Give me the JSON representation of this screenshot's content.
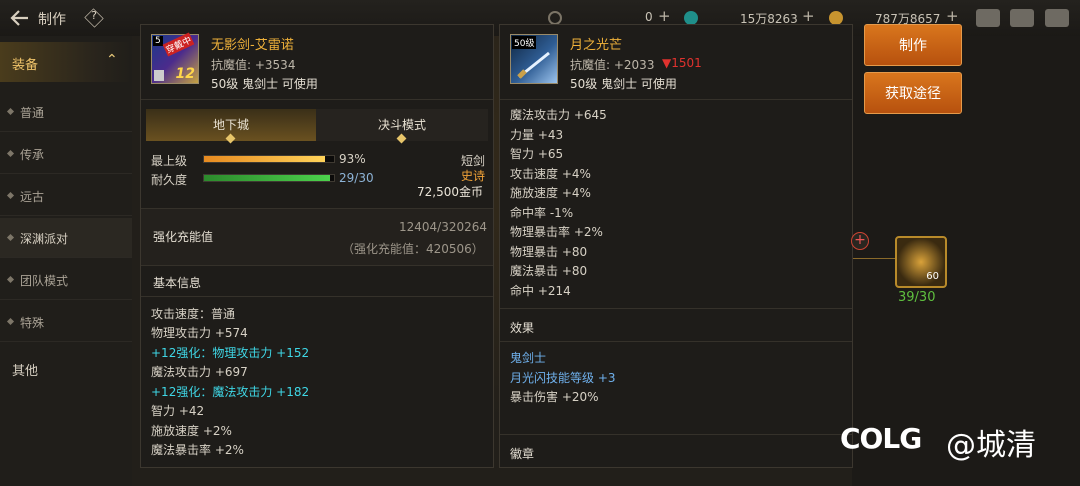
{
  "topbar": {
    "title": "制作",
    "help": "?",
    "currencies": [
      {
        "value": "0",
        "icon": "coin-c-icon"
      },
      {
        "value": "15万8263",
        "icon": "gem-icon"
      },
      {
        "value": "787万8657",
        "icon": "gold-icon"
      }
    ]
  },
  "sidebar": {
    "category_equip": "装备",
    "items": [
      "普通",
      "传承",
      "远古",
      "深渊派对",
      "团队模式",
      "特殊"
    ],
    "category_other": "其他"
  },
  "left_item": {
    "name": "无影剑-艾雷诺",
    "level_badge": "5",
    "enhance_badge": "12",
    "tag": "穿戴中",
    "anti_magic": "抗魔值: +3534",
    "requirement": "50级 鬼剑士 可使用",
    "tabs": [
      "地下城",
      "决斗模式"
    ],
    "upgrade_label": "最上级",
    "upgrade_pct": "93%",
    "upgrade_fill": 0.93,
    "durability_label": "耐久度",
    "durability_value": "29/30",
    "durability_fill": 0.967,
    "weapon_type": "短剑",
    "rarity": "史诗",
    "price": "72,500金币",
    "charge_title": "强化充能值",
    "charge_value": "12404/320264",
    "charge_sub": "（强化充能值：420506）",
    "basic_title": "基本信息",
    "stats": [
      {
        "text": "攻击速度：普通",
        "style": "stat"
      },
      {
        "text": "物理攻击力 +574",
        "style": "stat"
      },
      {
        "text": "+12强化：物理攻击力 +152",
        "style": "cyan"
      },
      {
        "text": "魔法攻击力 +697",
        "style": "stat"
      },
      {
        "text": "+12强化：魔法攻击力 +182",
        "style": "cyan"
      },
      {
        "text": "智力 +42",
        "style": "stat"
      },
      {
        "text": "施放速度 +2%",
        "style": "stat"
      },
      {
        "text": "魔法暴击率 +2%",
        "style": "stat"
      }
    ]
  },
  "right_item": {
    "name": "月之光芒",
    "level_badge": "50级",
    "anti_magic": "抗魔值: +2033",
    "anti_magic_diff": "▼1501",
    "requirement": "50级 鬼剑士 可使用",
    "stats": [
      "魔法攻击力 +645",
      "力量 +43",
      "智力 +65",
      "攻击速度 +4%",
      "施放速度 +4%",
      "命中率 -1%",
      "物理暴击率 +2%",
      "物理暴击 +80",
      "魔法暴击 +80",
      "命中 +214"
    ],
    "effect_title": "效果",
    "effects": [
      "鬼剑士",
      "月光闪技能等级 +3",
      "暴击伤害 +20%"
    ],
    "badge_title": "徽章"
  },
  "actions": {
    "make": "制作",
    "source": "获取途径"
  },
  "material": {
    "count": "39/30",
    "badge": "60"
  },
  "watermark": {
    "logo": "COLG",
    "user": "@城清"
  },
  "colors": {
    "orange": "#d9761d",
    "gold": "#f0b23a",
    "cyan": "#3fd7e6",
    "red": "#e0322e",
    "green": "#3bb33b"
  }
}
